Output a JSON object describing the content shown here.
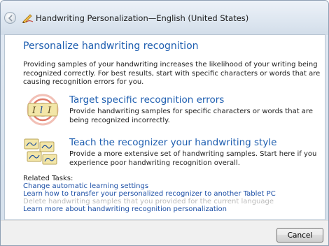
{
  "window": {
    "title": "Handwriting Personalization—English (United States)",
    "back_icon": "back-arrow-icon",
    "app_icon": "pen-tablet-icon"
  },
  "main": {
    "heading": "Personalize handwriting recognition",
    "intro": "Providing samples of your handwriting increases the likelihood of your writing being recognized correctly. For best results, start with specific characters or words that are causing recognition errors for you.",
    "options": [
      {
        "title": "Target specific recognition errors",
        "description": "Provide handwriting samples for specific characters or words that are being recognized incorrectly.",
        "icon": "target-errors-icon"
      },
      {
        "title": "Teach the recognizer your handwriting style",
        "description": "Provide a more extensive set of handwriting samples. Start here if you experience poor handwriting recognition overall.",
        "icon": "handwriting-samples-icon"
      }
    ],
    "related_label": "Related Tasks:",
    "related_tasks": [
      {
        "label": "Change automatic learning settings",
        "enabled": true
      },
      {
        "label": "Learn how to transfer your personalized recognizer to another Tablet PC",
        "enabled": true
      },
      {
        "label": "Delete handwriting samples that you provided for the current language",
        "enabled": false
      },
      {
        "label": "Learn more about handwriting recognition personalization",
        "enabled": true
      }
    ]
  },
  "footer": {
    "cancel_label": "Cancel"
  },
  "colors": {
    "link": "#1c4fa6",
    "heading": "#1e5eb0",
    "disabled": "#bcbcbc",
    "target_ring": "#e07b6a",
    "card": "#f3e6a8"
  }
}
